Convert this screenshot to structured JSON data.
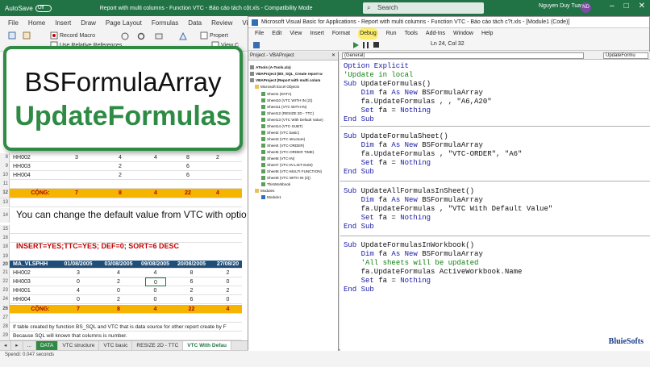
{
  "excel": {
    "autosave_label": "AutoSave",
    "autosave_state": "Off",
    "window_title": "Report with multi columns - Function VTC - Báo cáo tách cột.xls - Compatibility Mode",
    "search_placeholder": "Search",
    "user_name": "Nguyen Duy Tuan",
    "user_initials": "ND",
    "menu": [
      "File",
      "Home",
      "Insert",
      "Draw",
      "Page Layout",
      "Formulas",
      "Data",
      "Review",
      "View"
    ],
    "ribbon": {
      "record_macro": "Record Macro",
      "relative_refs": "Use Relative References",
      "properties": "Propert",
      "view_code": "View C"
    },
    "card": {
      "line1": "BSFormulaArray",
      "line2": "UpdateFormulas"
    },
    "top_rows": [
      {
        "num": "8",
        "cells": [
          "HH002",
          "3",
          "4",
          "4",
          "8",
          "2"
        ]
      },
      {
        "num": "9",
        "cells": [
          "HH003",
          "",
          "2",
          "",
          "6",
          ""
        ]
      },
      {
        "num": "10",
        "cells": [
          "HH004",
          "",
          "2",
          "",
          "6",
          ""
        ]
      },
      {
        "num": "11",
        "cells": [
          "",
          "",
          "",
          "",
          "",
          ""
        ]
      },
      {
        "num": "12",
        "cells": [
          "CỘNG:",
          "7",
          "8",
          "4",
          "22",
          "4"
        ]
      },
      {
        "num": "13",
        "cells": [
          "",
          "",
          "",
          "",
          "",
          ""
        ]
      }
    ],
    "row14_text": "You can change the default value from VTC with optio",
    "row15_num": "15",
    "row16_num": "16",
    "row18_text": "INSERT=YES;TTC=YES; DEF=0; SORT=6 DESC",
    "row18_num": "18",
    "row19_num": "19",
    "header_row": {
      "num": "20",
      "cells": [
        "MA_VLSPHH",
        "01/08/2005",
        "03/08/2005",
        "09/08/2005",
        "20/08/2005",
        "27/08/20"
      ]
    },
    "data_rows": [
      {
        "num": "21",
        "cells": [
          "HH002",
          "3",
          "4",
          "4",
          "8",
          "2"
        ]
      },
      {
        "num": "22",
        "cells": [
          "HH003",
          "0",
          "2",
          "0",
          "6",
          "0"
        ]
      },
      {
        "num": "23",
        "cells": [
          "HH001",
          "4",
          "0",
          "0",
          "2",
          "2"
        ]
      },
      {
        "num": "24",
        "cells": [
          "HH004",
          "0",
          "2",
          "0",
          "6",
          "0"
        ]
      },
      {
        "num": "25",
        "cells": [
          "",
          "",
          "",
          "",
          "",
          ""
        ]
      },
      {
        "num": "26",
        "cells": [
          "CỘNG:",
          "7",
          "8",
          "4",
          "22",
          "4"
        ]
      },
      {
        "num": "27",
        "cells": [
          "",
          "",
          "",
          "",
          "",
          ""
        ]
      }
    ],
    "row28_text": "If table created by function BS_SQL and VTC that is data source for other report create by F",
    "row28_num": "28",
    "row29_text": "Because SQL will known that columns is number.",
    "row29_num": "29",
    "tabs": [
      "DATA",
      "VTC structure",
      "VTC basic",
      "RESIZE 2D - TTC",
      "VTC With Defau"
    ],
    "status": "Spendi: 0.047 seconds"
  },
  "vba": {
    "title": "Microsoft Visual Basic for Applications - Report with multi columns - Function VTC - Báo cáo tách c?t.xls - [Module1 (Code)]",
    "menu": [
      "File",
      "Edit",
      "View",
      "Insert",
      "Format",
      "Debug",
      "Run",
      "Tools",
      "Add-Ins",
      "Window",
      "Help"
    ],
    "position": "Ln 24, Col 32",
    "project_title": "Project - VBAProject",
    "tree": [
      "ATools (A-Tools.xla)",
      "VBAProject (BS_SQL_Create report w",
      "VBAProject (Report with multi colum",
      "Microsoft Excel Objects",
      "Sheet1 (DATA)",
      "Sheet10 (VTC WITH IN (2))",
      "Sheet11 (VTC WITH IN)",
      "Sheet12 (RESIZE 2D - TTC)",
      "Sheet13 (VTC With Default Value)",
      "Sheet14 (VTC-SUBT)",
      "Sheet2 (VTC basic)",
      "Sheet3 (VTC structure)",
      "Sheet4 (VTC-ORDER)",
      "Sheet5 (VTC-ORDER TIME)",
      "Sheet6 (VTC-IN)",
      "Sheet7 (VTC-IN LIST-SUM)",
      "Sheet8 (VTC-MULTI FUNCTION)",
      "Sheet9 (VTC WITH IN (2))",
      "ThisWorkbook",
      "Modules",
      "Module1"
    ],
    "dropdown_left": "(General)",
    "dropdown_right": "UpdateFormu",
    "logo": "BluieSofts"
  }
}
